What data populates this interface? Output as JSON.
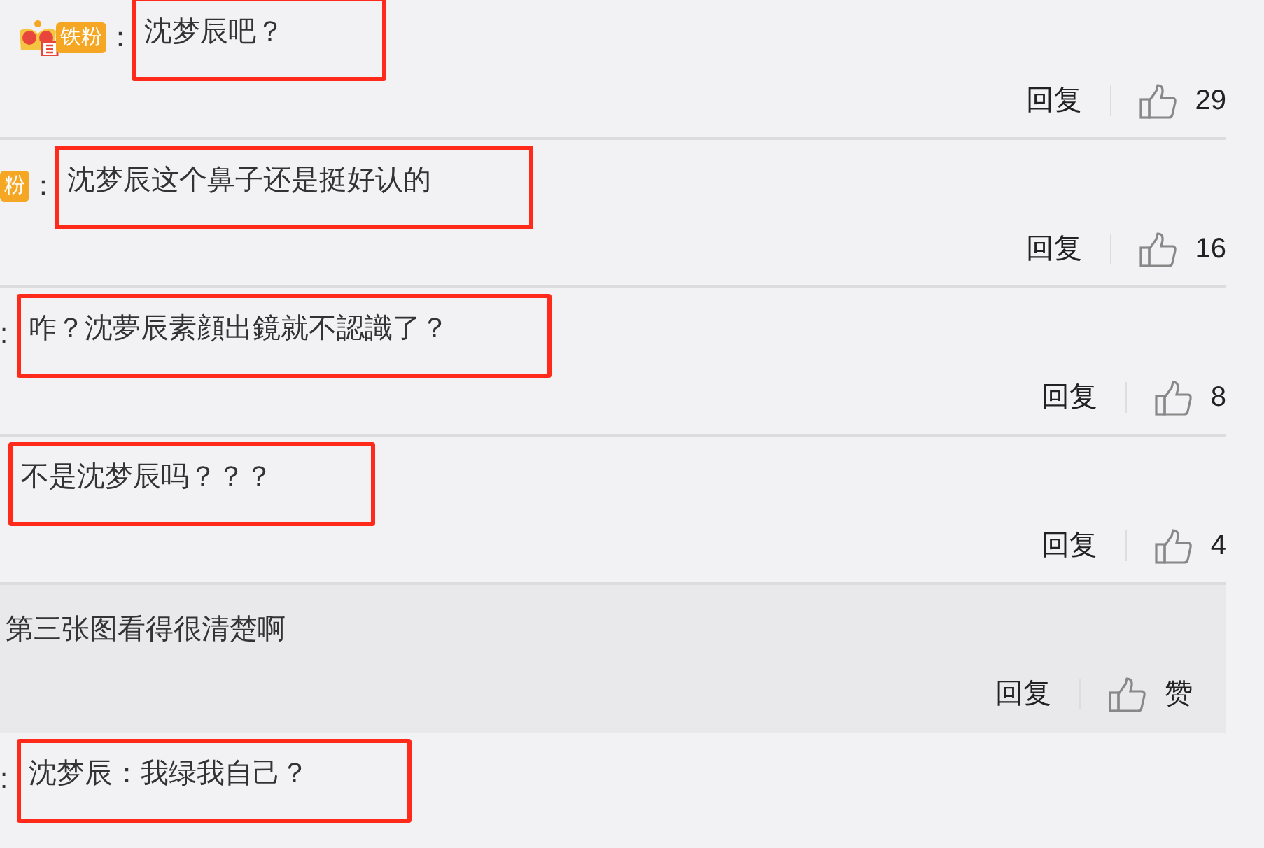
{
  "comments": [
    {
      "badge": {
        "label": "铁粉",
        "crown": true
      },
      "separator": "：",
      "text": "沈梦辰吧？",
      "annotated": true,
      "highlighted": false,
      "reply": "回复",
      "likes": "29"
    },
    {
      "badge": {
        "label": "粉",
        "crown": false
      },
      "separator": "：",
      "text": "沈梦辰这个鼻子还是挺好认的",
      "annotated": true,
      "highlighted": false,
      "reply": "回复",
      "likes": "16"
    },
    {
      "separator": ":",
      "text": "咋？沈夢辰素顔出鏡就不認識了？",
      "annotated": true,
      "highlighted": false,
      "reply": "回复",
      "likes": "8"
    },
    {
      "text": "不是沈梦辰吗？？？",
      "annotated": true,
      "highlighted": false,
      "reply": "回复",
      "likes": "4"
    },
    {
      "text": "第三张图看得很清楚啊",
      "annotated": false,
      "highlighted": true,
      "reply": "回复",
      "likes": "赞"
    },
    {
      "separator": ":",
      "text": "沈梦辰：我绿我自己？",
      "annotated": true,
      "highlighted": false
    }
  ]
}
